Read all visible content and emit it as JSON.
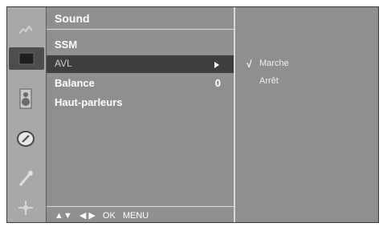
{
  "menu": {
    "title": "Sound",
    "items": [
      {
        "label": "SSM",
        "value": ""
      },
      {
        "label": "AVL",
        "value": ""
      },
      {
        "label": "Balance",
        "value": "0"
      },
      {
        "label": "Haut-parleurs",
        "value": ""
      }
    ],
    "selected_index": 1
  },
  "submenu": {
    "check_mark": "√",
    "options": [
      {
        "label": "Marche",
        "checked": true
      },
      {
        "label": "Arrêt",
        "checked": false
      }
    ]
  },
  "footer": {
    "nav_arrows_vertical": "▲▼",
    "nav_arrows_horizontal": "◀ ▶",
    "ok": "OK",
    "menu": "MENU"
  },
  "rail_icons": [
    "picture-icon",
    "sound-icon",
    "speaker-icon",
    "time-icon",
    "option-icon",
    "input-icon"
  ],
  "colors": {
    "panel": "#8f8f8f",
    "selected_row": "#3e3e3e",
    "text": "#ffffff"
  }
}
